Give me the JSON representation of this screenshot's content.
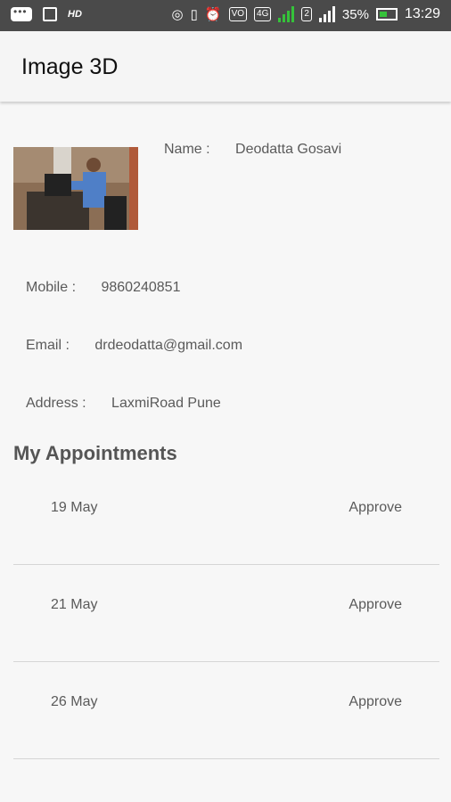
{
  "status_bar": {
    "hd": "HD",
    "volte": "VO",
    "network": "4G",
    "sim2": "2",
    "battery_percent": "35%",
    "time": "13:29"
  },
  "app": {
    "title": "Image 3D"
  },
  "profile": {
    "name_label": "Name :",
    "name_value": "Deodatta Gosavi",
    "mobile_label": "Mobile :",
    "mobile_value": "9860240851",
    "email_label": "Email :",
    "email_value": "drdeodatta@gmail.com",
    "address_label": "Address :",
    "address_value": "LaxmiRoad Pune"
  },
  "appointments": {
    "title": "My Appointments",
    "items": [
      {
        "date": "19 May",
        "status": "Approve"
      },
      {
        "date": "21 May",
        "status": "Approve"
      },
      {
        "date": "26 May",
        "status": "Approve"
      }
    ]
  }
}
